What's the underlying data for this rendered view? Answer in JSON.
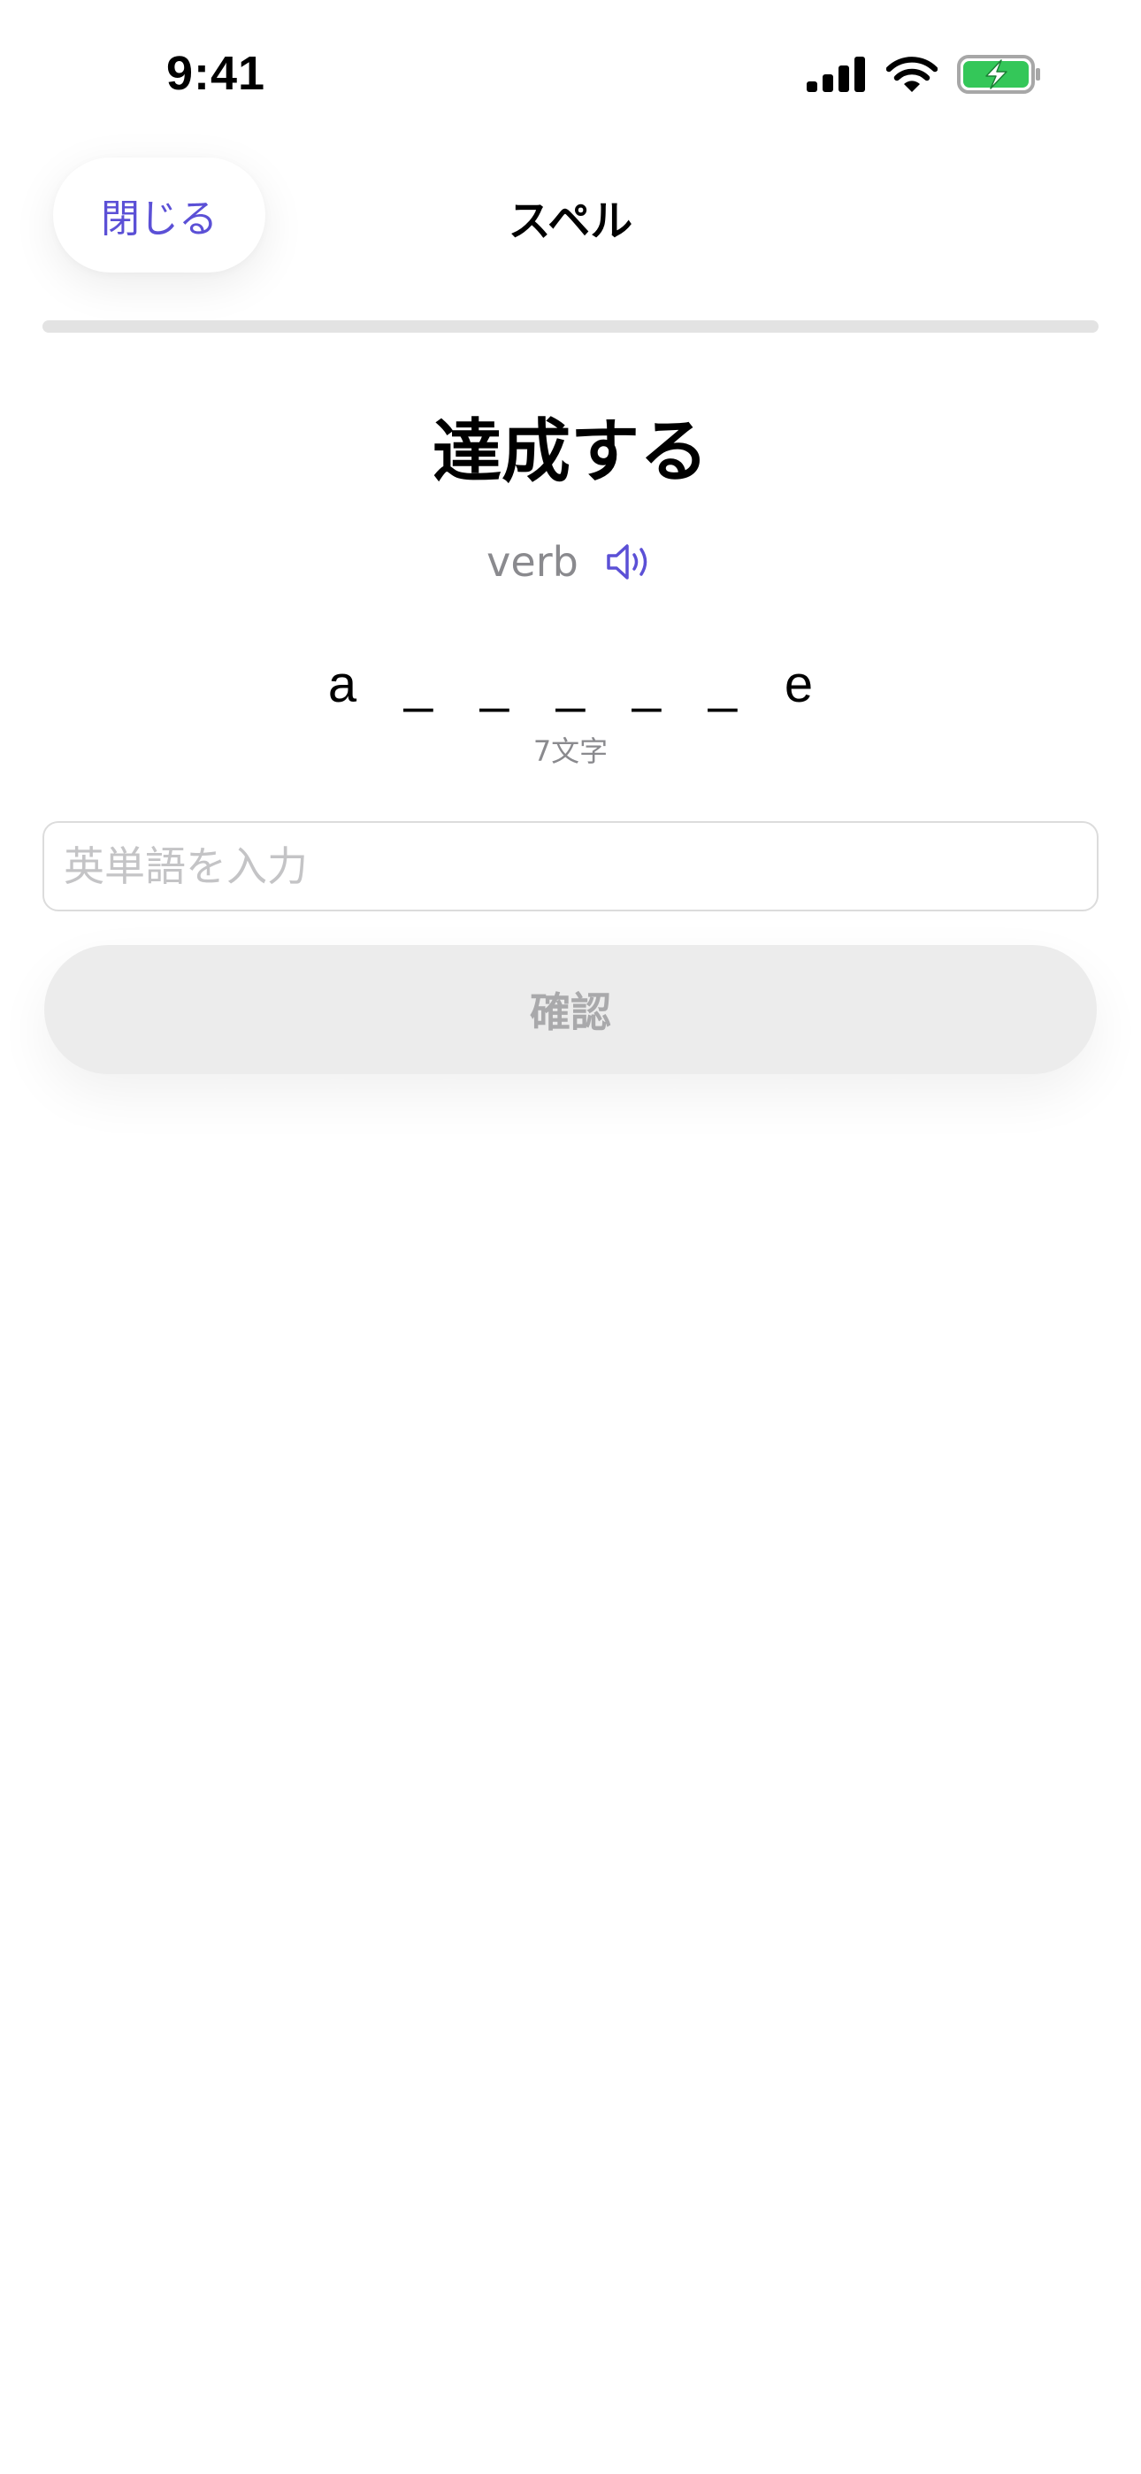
{
  "status_bar": {
    "time": "9:41",
    "icons": [
      "cellular-signal-icon",
      "wifi-icon",
      "battery-charging-icon"
    ]
  },
  "header": {
    "close_label": "閉じる",
    "title": "スペル"
  },
  "progress": {
    "value": 0.0
  },
  "question": {
    "word": "達成する",
    "part_of_speech": "verb",
    "speaker_icon": "speaker-icon"
  },
  "hint": {
    "letters": [
      "a",
      "_",
      "_",
      "_",
      "_",
      "_",
      "e"
    ],
    "count_label": "7文字"
  },
  "answer": {
    "value": "",
    "placeholder": "英単語を入力"
  },
  "confirm": {
    "label": "確認",
    "enabled": false
  },
  "colors": {
    "accent": "#5b50d6",
    "battery_green": "#34c759",
    "muted_text": "#8a8a8e",
    "disabled_button_bg": "#ececec",
    "disabled_button_text": "#a9a9ab",
    "progress_track": "#e3e3e3"
  }
}
